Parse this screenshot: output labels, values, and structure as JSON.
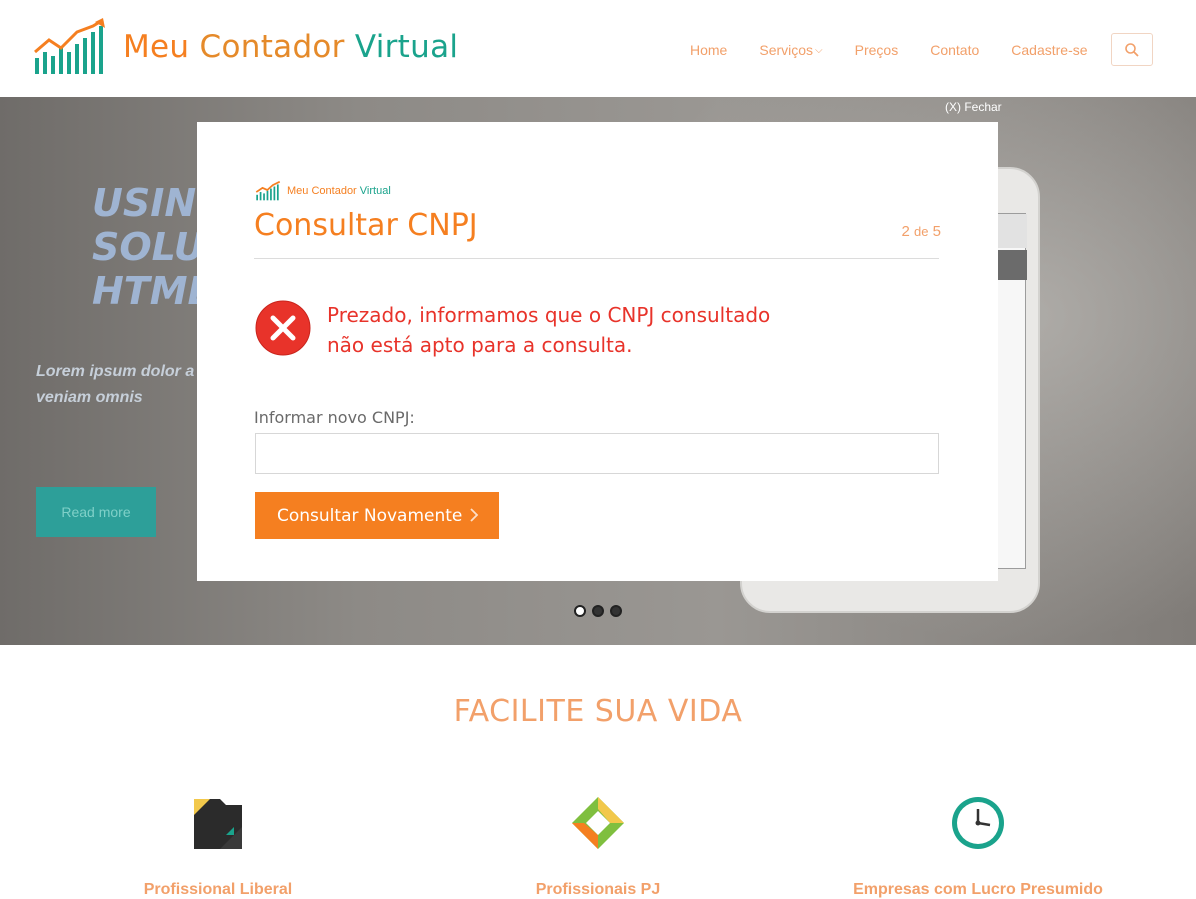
{
  "header": {
    "logo": {
      "word1": "Meu",
      "word2": "Contador",
      "word3": "Virtual",
      "icon": "bar-chart-arrow-icon"
    },
    "nav": {
      "home": "Home",
      "services": "Serviços",
      "prices": "Preços",
      "contact": "Contato",
      "signup": "Cadastre-se"
    },
    "search_icon": "search-icon"
  },
  "hero": {
    "title_line1": "USING",
    "title_line2": "SOLU",
    "title_line3": "HTML",
    "subtitle": "Lorem ipsum dolor a tempor incididunt ut veniam omnis",
    "read_more": "Read more",
    "slider_dots": 3,
    "active_dot": 0
  },
  "modal": {
    "close_label": "(X) Fechar",
    "logo": {
      "word1": "Meu",
      "word2": "Contador",
      "word3": "Virtual"
    },
    "title": "Consultar CNPJ",
    "step_current": "2",
    "step_sep": "de",
    "step_total": "5",
    "error_line1": "Prezado, informamos que o CNPJ consultado",
    "error_line2": "não está apto para a consulta.",
    "error_icon": "error-x-icon",
    "input_label": "Informar novo CNPJ:",
    "input_value": "",
    "button_label": "Consultar Novamente",
    "button_icon": "chevron-right-icon"
  },
  "section": {
    "title": "FACILITE SUA VIDA",
    "features": [
      {
        "title": "Profissional Liberal",
        "icon": "folder-icon"
      },
      {
        "title": "Profissionais PJ",
        "icon": "diamond-icon"
      },
      {
        "title": "Empresas com Lucro Presumido",
        "icon": "clock-icon"
      }
    ]
  },
  "colors": {
    "brand_orange": "#f57f20",
    "brand_teal": "#1aa38c",
    "error_red": "#e8332a"
  }
}
